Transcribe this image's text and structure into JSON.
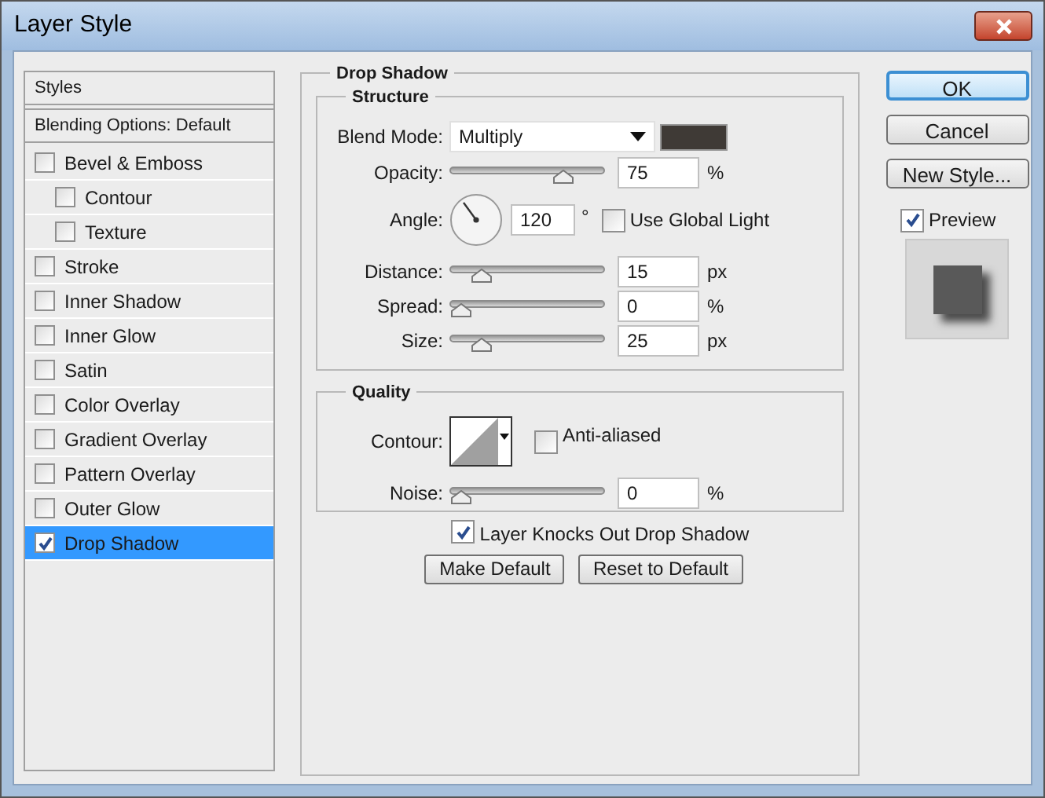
{
  "window": {
    "title": "Layer Style"
  },
  "styles_list": {
    "header": "Styles",
    "blending": "Blending Options: Default",
    "items": [
      {
        "label": "Bevel & Emboss",
        "checked": false,
        "selected": false,
        "children": [
          {
            "label": "Contour",
            "checked": false,
            "selected": false
          },
          {
            "label": "Texture",
            "checked": false,
            "selected": false
          }
        ]
      },
      {
        "label": "Stroke",
        "checked": false,
        "selected": false
      },
      {
        "label": "Inner Shadow",
        "checked": false,
        "selected": false
      },
      {
        "label": "Inner Glow",
        "checked": false,
        "selected": false
      },
      {
        "label": "Satin",
        "checked": false,
        "selected": false
      },
      {
        "label": "Color Overlay",
        "checked": false,
        "selected": false
      },
      {
        "label": "Gradient Overlay",
        "checked": false,
        "selected": false
      },
      {
        "label": "Pattern Overlay",
        "checked": false,
        "selected": false
      },
      {
        "label": "Outer Glow",
        "checked": false,
        "selected": false
      },
      {
        "label": "Drop Shadow",
        "checked": true,
        "selected": true
      }
    ]
  },
  "panel": {
    "title": "Drop Shadow",
    "structure": {
      "title": "Structure",
      "rows": [
        {
          "kind": "select",
          "label": "Blend Mode:",
          "value": "Multiply",
          "color": "#3f3a36"
        },
        {
          "kind": "slider",
          "label": "Opacity:",
          "level": 0.75,
          "value": "75",
          "unit": "%"
        },
        {
          "kind": "angle",
          "label": "Angle:",
          "value": "120",
          "unit": "°",
          "checkbox": {
            "label": "Use Global Light",
            "checked": false
          }
        },
        {
          "kind": "slider",
          "label": "Distance:",
          "level": 0.15,
          "value": "15",
          "unit": "px"
        },
        {
          "kind": "slider",
          "label": "Spread:",
          "level": 0,
          "value": "0",
          "unit": "%"
        },
        {
          "kind": "slider",
          "label": "Size:",
          "level": 0.15,
          "value": "25",
          "unit": "px"
        }
      ]
    },
    "quality": {
      "title": "Quality",
      "rows": [
        {
          "kind": "contour",
          "label": "Contour:",
          "checkbox": {
            "label": "Anti-aliased",
            "checked": false
          }
        },
        {
          "kind": "slider",
          "label": "Noise:",
          "level": 0,
          "value": "0",
          "unit": "%"
        }
      ]
    },
    "knockout": {
      "label": "Layer Knocks Out Drop Shadow",
      "checked": true
    },
    "buttons": [
      "Make Default",
      "Reset to Default"
    ]
  },
  "actions": {
    "buttons": [
      {
        "label": "OK",
        "default": true
      },
      {
        "label": "Cancel",
        "default": false
      },
      {
        "label": "New Style...",
        "default": false
      }
    ],
    "preview": {
      "label": "Preview",
      "checked": true
    }
  }
}
